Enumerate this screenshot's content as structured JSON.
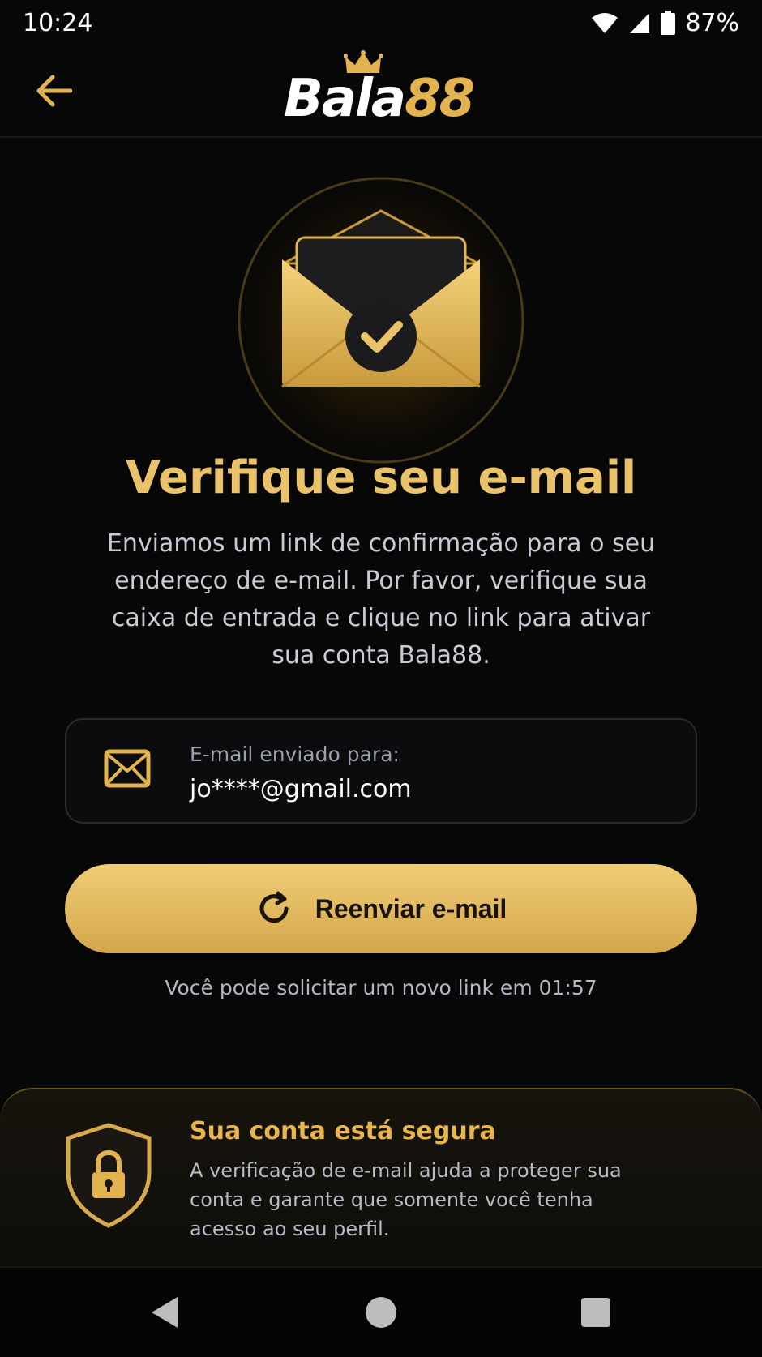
{
  "status": {
    "time": "10:24",
    "battery": "87%"
  },
  "appbar": {
    "logo_main": "Bala",
    "logo_num": "88"
  },
  "content": {
    "title": "Verifique seu e-mail",
    "description": "Enviamos um link de confirmação para o seu endereço de e-mail. Por favor, verifique sua caixa de entrada e clique no link para ativar sua conta Bala88."
  },
  "email_card": {
    "label": "E-mail enviado para:",
    "value": "jo****@gmail.com"
  },
  "resend": {
    "label": "Reenviar e-mail"
  },
  "countdown": {
    "text": "Você pode solicitar um novo link em 01:57"
  },
  "security": {
    "title": "Sua conta está segura",
    "description": "A verificação de e-mail ajuda a proteger sua conta e garante que somente você tenha acesso ao seu perfil."
  },
  "colors": {
    "accent_gold": "#e3b34f",
    "background": "#070707"
  }
}
